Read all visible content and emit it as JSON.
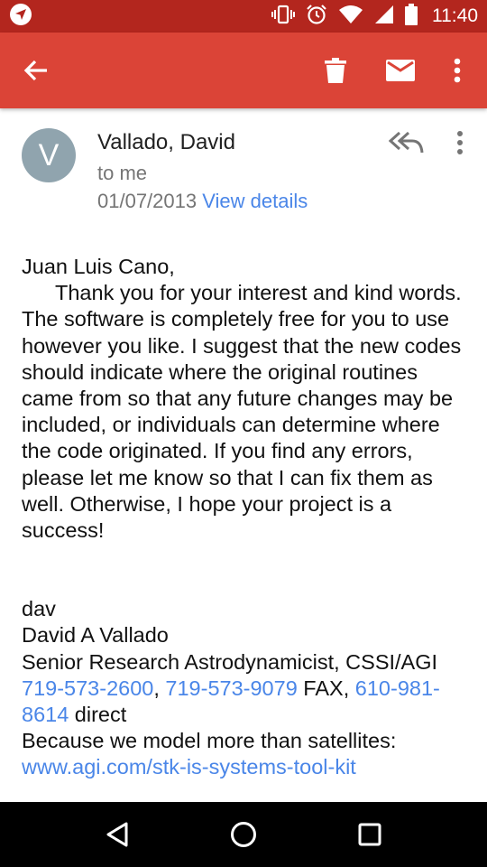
{
  "status_bar": {
    "time": "11:40",
    "icons": [
      "navigation-icon",
      "vibrate-icon",
      "alarm-icon",
      "wifi-icon",
      "signal-icon",
      "battery-icon"
    ]
  },
  "app_bar": {
    "color": "#db4437",
    "icons": [
      "back-arrow-icon",
      "trash-icon",
      "mail-icon",
      "more-vert-icon"
    ]
  },
  "email": {
    "avatar_letter": "V",
    "sender": "Vallado, David",
    "to": "to me",
    "date": "01/07/2013",
    "view_details": "View details",
    "body": {
      "greeting": "Juan Luis Cano,",
      "paragraph": "Thank you for your interest and kind words. The software is completely free for you to use however you like. I suggest that the new codes should indicate where the original routines came from so that any future changes may be included, or individuals can determine where the code originated. If you find any errors, please let me know so that I can fix them as well. Otherwise, I hope your project is a success!",
      "sig_short": "dav",
      "sig_name": "David A Vallado",
      "sig_title": "Senior Research Astrodynamicist, CSSI/AGI",
      "phone1": "719-573-2600",
      "sep1": ", ",
      "phone2": "719-573-9079",
      "fax_label": " FAX, ",
      "phone3": "610-981-8614",
      "direct_label": " direct",
      "tagline": "Because we model more than satellites:",
      "url": "www.agi.com/stk-is-systems-tool-kit"
    }
  },
  "nav_bar": {
    "icons": [
      "back-triangle-icon",
      "home-circle-icon",
      "recents-square-icon"
    ]
  }
}
